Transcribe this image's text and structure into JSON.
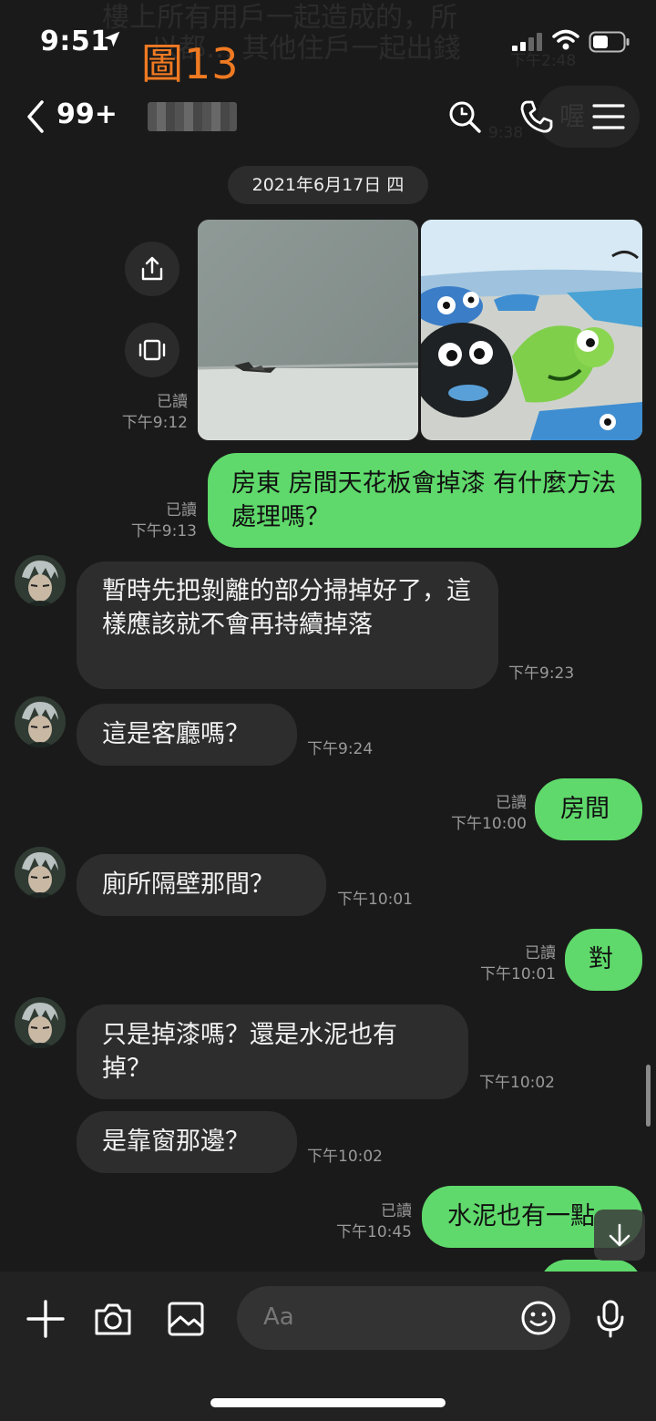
{
  "status": {
    "time": "9:51"
  },
  "overlay_label": "圖13",
  "ghost_text": {
    "line1": "樓上所有用戶一起造成的，所",
    "line2": "以都… 其他住戶一起出錢",
    "time1": "下午2:48",
    "bubble": "喔",
    "time2": "9:38"
  },
  "header": {
    "unread_count": "99+"
  },
  "date_pill": "2021年6月17日 四",
  "messages": [
    {
      "dir": "out",
      "read": "已讀",
      "time": "下午9:12"
    },
    {
      "dir": "out",
      "text": "房東 房間天花板會掉漆 有什麼方法處理嗎？",
      "read": "已讀",
      "time": "下午9:13"
    },
    {
      "dir": "in",
      "text": "暫時先把剝離的部分掃掉好了，這樣應該就不會再持續掉落",
      "time": "下午9:23"
    },
    {
      "dir": "in",
      "text": "這是客廳嗎？",
      "time": "下午9:24"
    },
    {
      "dir": "out",
      "text": "房間",
      "read": "已讀",
      "time": "下午10:00"
    },
    {
      "dir": "in",
      "text": "廁所隔壁那間？",
      "time": "下午10:01"
    },
    {
      "dir": "out",
      "text": "對",
      "read": "已讀",
      "time": "下午10:01"
    },
    {
      "dir": "in",
      "text": "只是掉漆嗎？還是水泥也有掉？",
      "time": "下午10:02"
    },
    {
      "dir": "in",
      "text": "是靠窗那邊？",
      "time": "下午10:02"
    },
    {
      "dir": "out",
      "text": "水泥也有一點",
      "read": "已讀",
      "time": "下午10:45"
    }
  ],
  "footer": {
    "input_placeholder": "Aa"
  },
  "colors": {
    "outgoing_bubble": "#5fd96b",
    "incoming_bubble": "#2d2d2d",
    "background": "#1a1a1a",
    "overlay_label": "#f07a22"
  },
  "icons": [
    "location-arrow-icon",
    "signal-icon",
    "wifi-icon",
    "battery-icon",
    "back-icon",
    "search-icon",
    "phone-icon",
    "menu-icon",
    "share-icon",
    "album-icon",
    "plus-icon",
    "camera-icon",
    "image-icon",
    "emoji-icon",
    "microphone-icon",
    "arrow-down-icon"
  ]
}
